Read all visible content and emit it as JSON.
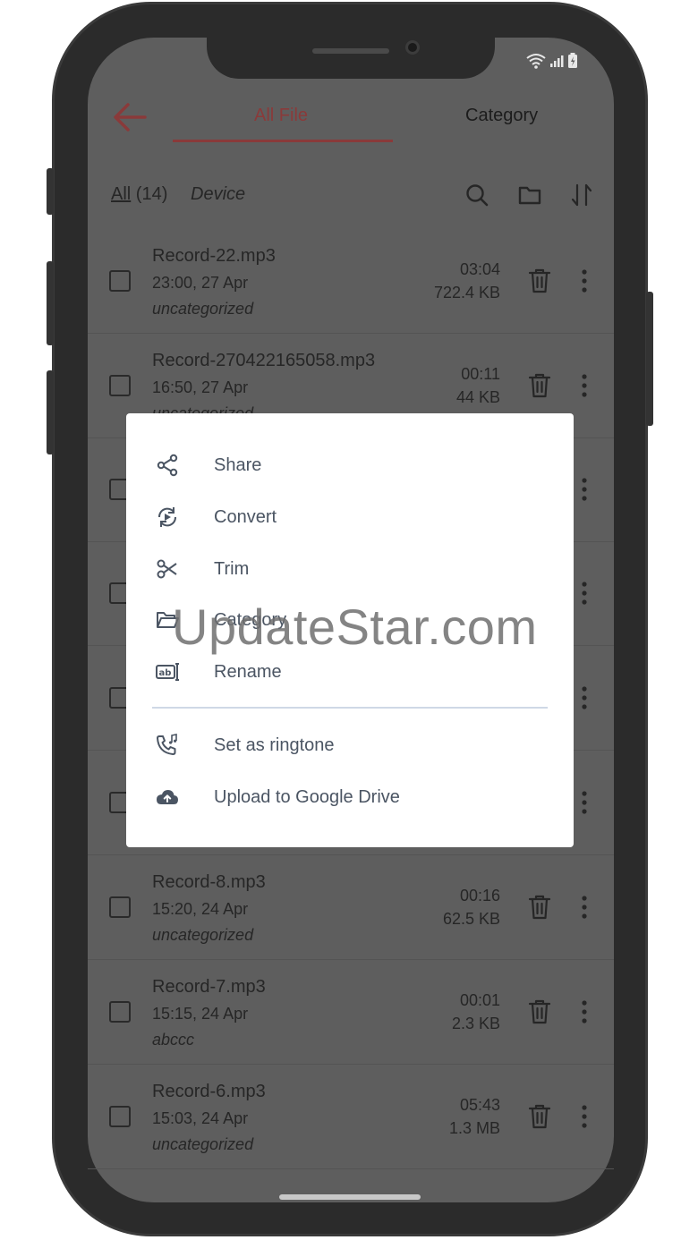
{
  "header": {
    "tabs": [
      {
        "label": "All File",
        "active": true
      },
      {
        "label": "Category",
        "active": false
      }
    ]
  },
  "filter": {
    "all_label": "All",
    "count_label": "(14)",
    "device_label": "Device"
  },
  "records": [
    {
      "name": "Record-22.mp3",
      "date": "23:00, 27 Apr",
      "category": "uncategorized",
      "duration": "03:04",
      "size": "722.4 KB"
    },
    {
      "name": "Record-270422165058.mp3",
      "date": "16:50, 27 Apr",
      "category": "uncategorized",
      "duration": "00:11",
      "size": "44 KB"
    },
    {
      "name": "Record-8.mp3",
      "date": "15:20, 24 Apr",
      "category": "uncategorized",
      "duration": "00:16",
      "size": "62.5 KB"
    },
    {
      "name": "Record-7.mp3",
      "date": "15:15, 24 Apr",
      "category": "abccc",
      "duration": "00:01",
      "size": "2.3 KB"
    },
    {
      "name": "Record-6.mp3",
      "date": "15:03, 24 Apr",
      "category": "uncategorized",
      "duration": "05:43",
      "size": "1.3 MB"
    }
  ],
  "popup_menu": {
    "items": [
      {
        "label": "Share",
        "icon": "share-icon"
      },
      {
        "label": "Convert",
        "icon": "convert-icon"
      },
      {
        "label": "Trim",
        "icon": "scissors-icon"
      },
      {
        "label": "Category",
        "icon": "folder-open-icon"
      },
      {
        "label": "Rename",
        "icon": "rename-icon"
      }
    ],
    "secondary_items": [
      {
        "label": "Set as ringtone",
        "icon": "phone-music-icon"
      },
      {
        "label": "Upload to Google Drive",
        "icon": "cloud-upload-icon"
      }
    ]
  },
  "watermark": "UpdateStar.com",
  "colors": {
    "accent": "#8a3a3a",
    "overlay": "#5e5e5e",
    "popup_bg": "#ffffff",
    "menu_text": "#4b5563"
  }
}
